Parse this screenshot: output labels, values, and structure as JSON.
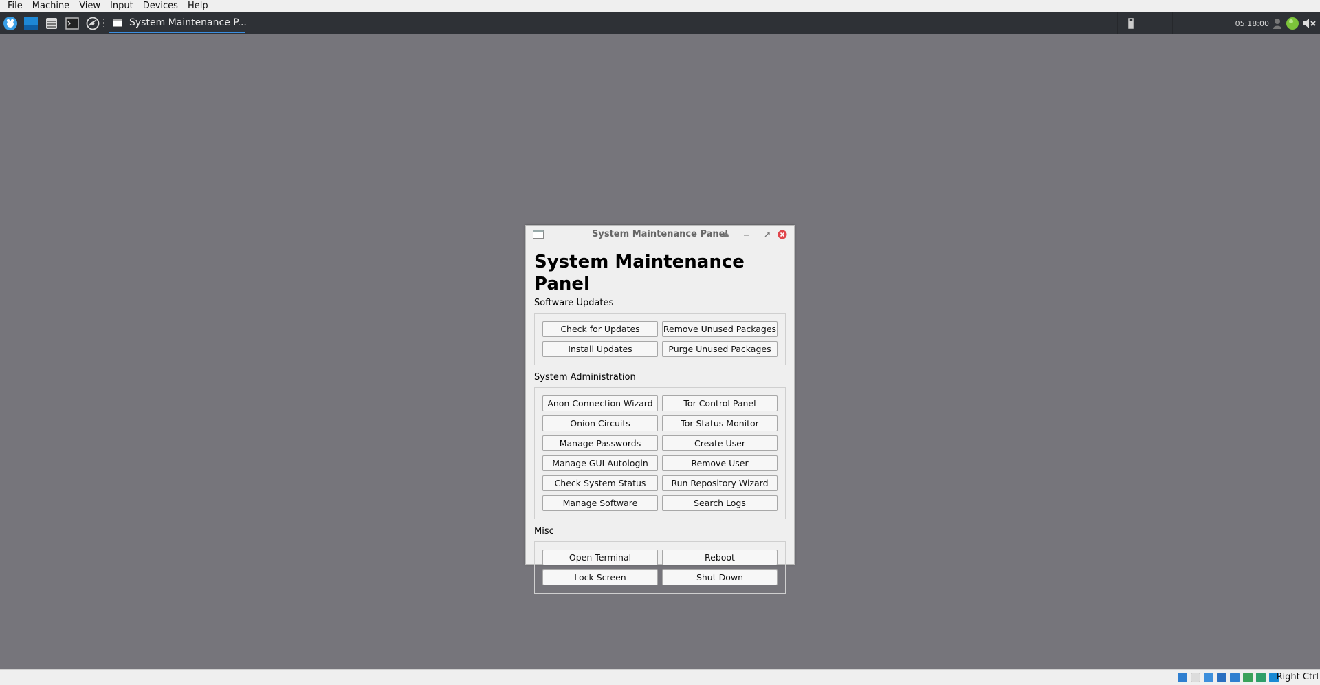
{
  "host_menubar": {
    "items": [
      "File",
      "Machine",
      "View",
      "Input",
      "Devices",
      "Help"
    ]
  },
  "taskbar": {
    "task_title": "System Maintenance P...",
    "clock": "05:18:00"
  },
  "window": {
    "title": "System Maintenance Panel",
    "heading": "System Maintenance Panel",
    "sections": [
      {
        "label": "Software Updates",
        "buttons": [
          "Check for Updates",
          "Remove Unused Packages",
          "Install Updates",
          "Purge Unused Packages"
        ]
      },
      {
        "label": "System Administration",
        "buttons": [
          "Anon Connection Wizard",
          "Tor Control Panel",
          "Onion Circuits",
          "Tor Status Monitor",
          "Manage Passwords",
          "Create User",
          "Manage GUI Autologin",
          "Remove User",
          "Check System Status",
          "Run Repository Wizard",
          "Manage Software",
          "Search Logs"
        ]
      },
      {
        "label": "Misc",
        "buttons": [
          "Open Terminal",
          "Reboot",
          "Lock Screen",
          "Shut Down"
        ]
      }
    ]
  },
  "host_status": {
    "host_key": "Right Ctrl"
  },
  "colors": {
    "desktop": "#76757b",
    "taskbar": "#2e3136",
    "task_underline": "#3b8ee0",
    "close_button": "#e0454b"
  }
}
